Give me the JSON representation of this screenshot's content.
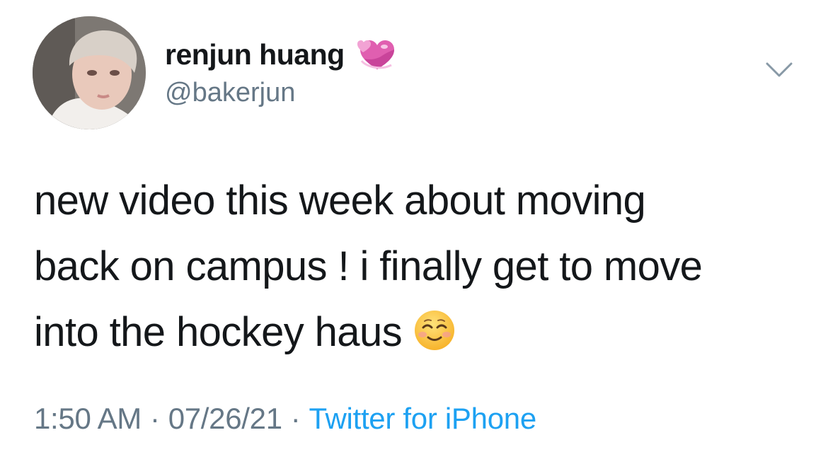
{
  "tweet": {
    "author": {
      "display_name": "renjun huang",
      "handle": "@bakerjun",
      "name_emoji_icon": "revolving-hearts-icon",
      "avatar_icon": "profile-photo"
    },
    "menu_icon": "chevron-down-icon",
    "text_lines": [
      "new video this week about moving",
      "back on campus ! i finally get to move",
      "into the hockey haus"
    ],
    "text_emoji_icon": "smiling-face-icon",
    "time": "1:50 AM",
    "separator": "·",
    "date": "07/26/21",
    "source": "Twitter for iPhone"
  },
  "colors": {
    "text": "#14171a",
    "secondary_text": "#657786",
    "link": "#1da1f2",
    "background": "#ffffff"
  }
}
